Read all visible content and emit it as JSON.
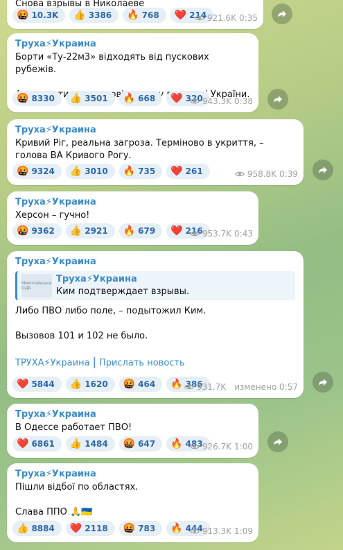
{
  "messages": [
    {
      "text": "Снова взрывы в Николаеве",
      "reactions": [
        {
          "emoji": "🤬",
          "count": "10.3K"
        },
        {
          "emoji": "👍",
          "count": "3386"
        },
        {
          "emoji": "🔥",
          "count": "768"
        },
        {
          "emoji": "❤️",
          "count": "214"
        }
      ],
      "views": "921.6K",
      "time": "0:35"
    },
    {
      "sender": "Труха⚡Украина",
      "text": "Борти «Ту-22м3» відходять від пускових рубежів.",
      "text2": "Але ракети ще є в повітряному просторі України.",
      "reactions": [
        {
          "emoji": "🤬",
          "count": "8330"
        },
        {
          "emoji": "👍",
          "count": "3501"
        },
        {
          "emoji": "🔥",
          "count": "668"
        },
        {
          "emoji": "❤️",
          "count": "320"
        }
      ],
      "views": "943.3K",
      "time": "0:38"
    },
    {
      "sender": "Труха⚡Украина",
      "text": "Кривий Ріг, реальна загроза. Терміново в укриття, – голова ВА Кривого Рогу.",
      "reactions": [
        {
          "emoji": "🤬",
          "count": "9324"
        },
        {
          "emoji": "👍",
          "count": "3010"
        },
        {
          "emoji": "🔥",
          "count": "735"
        },
        {
          "emoji": "❤️",
          "count": "261"
        }
      ],
      "views": "958.8K",
      "time": "0:39"
    },
    {
      "sender": "Труха⚡Украина",
      "text": "Херсон – гучно!",
      "reactions": [
        {
          "emoji": "🤬",
          "count": "9362"
        },
        {
          "emoji": "👍",
          "count": "2921"
        },
        {
          "emoji": "🔥",
          "count": "679"
        },
        {
          "emoji": "❤️",
          "count": "216"
        }
      ],
      "views": "953.7K",
      "time": "0:43"
    },
    {
      "sender": "Труха⚡Украина",
      "quote_sender": "Труха⚡Украина",
      "quote_text": "Ким подтверждает взрывы.",
      "quote_thumb": "Миколаївська ОДА",
      "text": "Либо ПВО либо поле, – подытожил Ким.",
      "text2": "Вызовов 101 и 102 не было.",
      "footer_link1": "ТРУХА⚡Украина",
      "footer_sep": "|",
      "footer_link2": "Прислать новость",
      "reactions": [
        {
          "emoji": "❤️",
          "count": "5844"
        },
        {
          "emoji": "👍",
          "count": "1620"
        },
        {
          "emoji": "🤬",
          "count": "464"
        },
        {
          "emoji": "🔥",
          "count": "386"
        }
      ],
      "views": "931.7K",
      "time": "изменено 0:57"
    },
    {
      "sender": "Труха⚡Украина",
      "text": "В Одессе работает ПВО!",
      "reactions": [
        {
          "emoji": "❤️",
          "count": "6861"
        },
        {
          "emoji": "👍",
          "count": "1484"
        },
        {
          "emoji": "🤬",
          "count": "647"
        },
        {
          "emoji": "🔥",
          "count": "483"
        }
      ],
      "views": "926.7K",
      "time": "1:00"
    },
    {
      "sender": "Труха⚡Украина",
      "text": "Пішли відбої по областях.",
      "text2": "Слава ППО 🙏🇺🇦",
      "reactions": [
        {
          "emoji": "👍",
          "count": "8884"
        },
        {
          "emoji": "❤️",
          "count": "2118"
        },
        {
          "emoji": "🤬",
          "count": "783"
        },
        {
          "emoji": "🔥",
          "count": "444"
        }
      ],
      "views": "913.3K",
      "time": "1:09"
    }
  ]
}
